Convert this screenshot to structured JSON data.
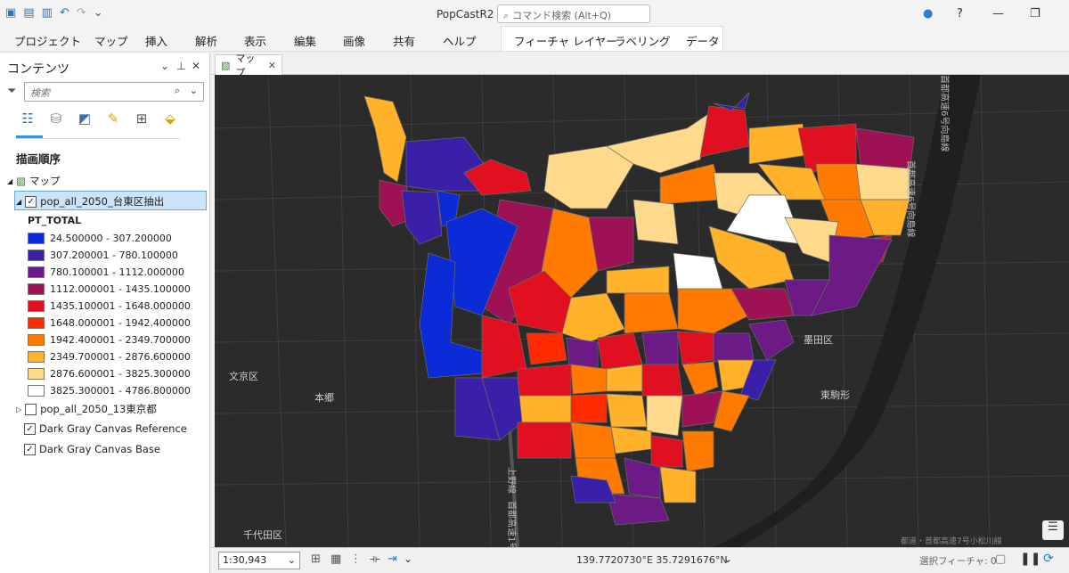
{
  "app": {
    "title": "PopCastR2"
  },
  "command_search": {
    "placeholder": "コマンド検索 (Alt+Q)"
  },
  "ribbon_tabs": [
    "プロジェクト",
    "マップ",
    "挿入",
    "解析",
    "表示",
    "編集",
    "画像",
    "共有",
    "ヘルプ",
    "フィーチャ レイヤー",
    "ラベリング",
    "データ"
  ],
  "contents": {
    "title": "コンテンツ",
    "search_placeholder": "検索",
    "section_title": "描画順序",
    "map_node": "マップ",
    "layers": [
      {
        "name": "pop_all_2050_台東区抽出",
        "checked": true
      },
      {
        "name": "pop_all_2050_13東京都",
        "checked": false
      },
      {
        "name": "Dark Gray Canvas Reference",
        "checked": true
      },
      {
        "name": "Dark Gray Canvas Base",
        "checked": true
      }
    ],
    "legend_field": "PT_TOTAL",
    "legend": [
      {
        "label": "24.500000 - 307.200000",
        "color": "#0a2bd6"
      },
      {
        "label": "307.200001 - 780.100000",
        "color": "#3a1fa8"
      },
      {
        "label": "780.100001 - 1112.000000",
        "color": "#6b1a86"
      },
      {
        "label": "1112.000001 - 1435.100000",
        "color": "#9e1255"
      },
      {
        "label": "1435.100001 - 1648.000000",
        "color": "#e01020"
      },
      {
        "label": "1648.000001 - 1942.400000",
        "color": "#ff2a00"
      },
      {
        "label": "1942.400001 - 2349.700000",
        "color": "#ff7a00"
      },
      {
        "label": "2349.700001 - 2876.600000",
        "color": "#ffb22a"
      },
      {
        "label": "2876.600001 - 3825.300000",
        "color": "#ffd98c"
      },
      {
        "label": "3825.300001 - 4786.800000",
        "color": "#ffffff"
      }
    ]
  },
  "map": {
    "tab_label": "マップ",
    "place_labels": [
      "文京区",
      "本郷",
      "墨田区",
      "東駒形",
      "千代田区"
    ],
    "road_labels": [
      "上野線",
      "首都高速1号",
      "首都高速6号向島線",
      "首都高速6号向島線"
    ],
    "attribution": "都道・首都高速7号小松川線"
  },
  "status": {
    "scale": "1:30,943",
    "coordinates": "139.7720730°E 35.7291676°N",
    "selected_features": "選択フィーチャ: 0"
  }
}
